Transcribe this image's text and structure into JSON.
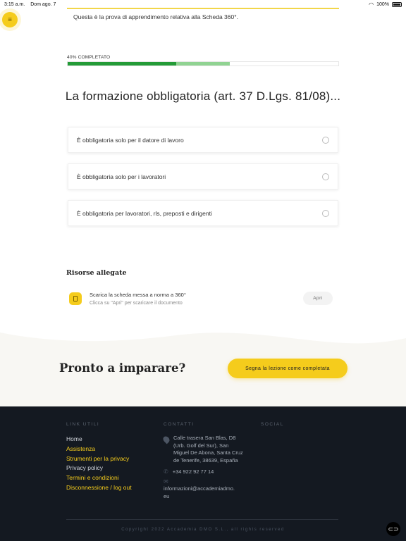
{
  "status_bar": {
    "time": "3:15 a.m.",
    "date": "Dom ago. 7",
    "battery": "100%"
  },
  "intro": "Questa è la prova di apprendimento relativa alla Scheda 360°.",
  "progress": {
    "label": "40% COMPLETATO",
    "completed_fraction": 0.4,
    "secondary_fraction": 0.6
  },
  "question": "La formazione obbligatoria (art. 37 D.Lgs. 81/08)...",
  "options": [
    "È obbligatoria solo per il datore di lavoro",
    "È obbligatoria solo per i lavoratori",
    "È obbligatoria per lavoratori, rls, preposti e dirigenti"
  ],
  "resources": {
    "title": "Risorse allegate",
    "item_name": "Scarica la scheda messa a norma a 360°",
    "item_hint": "Clicca su \"Apri\" per scaricare il documento",
    "open_label": "Apri"
  },
  "cta": {
    "title": "Pronto a imparare?",
    "button": "Segna la lezione come completata"
  },
  "footer": {
    "links_heading": "LINK UTILI",
    "contacts_heading": "CONTATTI",
    "social_heading": "SOCIAL",
    "links": [
      "Home",
      "Assistenza",
      "Strumenti per la privacy",
      "Privacy policy",
      "Termini e condizioni",
      "Disconnessione / log out"
    ],
    "address": "Calle trasera San Blas, D8 (Urb. Golf del Sur), San Miguel De Abona, Santa Cruz de Tenerife, 38639, España",
    "phone": "+34 922 92 77 14",
    "email_line1": "informazioni@accademiadmo.",
    "email_line2": "eu",
    "copyright": "Copyright 2022 Accademia DMO S.L., all rights reserved"
  },
  "colors": {
    "accent": "#f5cc1c",
    "progress": "#239b37",
    "footer_bg": "#141921"
  }
}
